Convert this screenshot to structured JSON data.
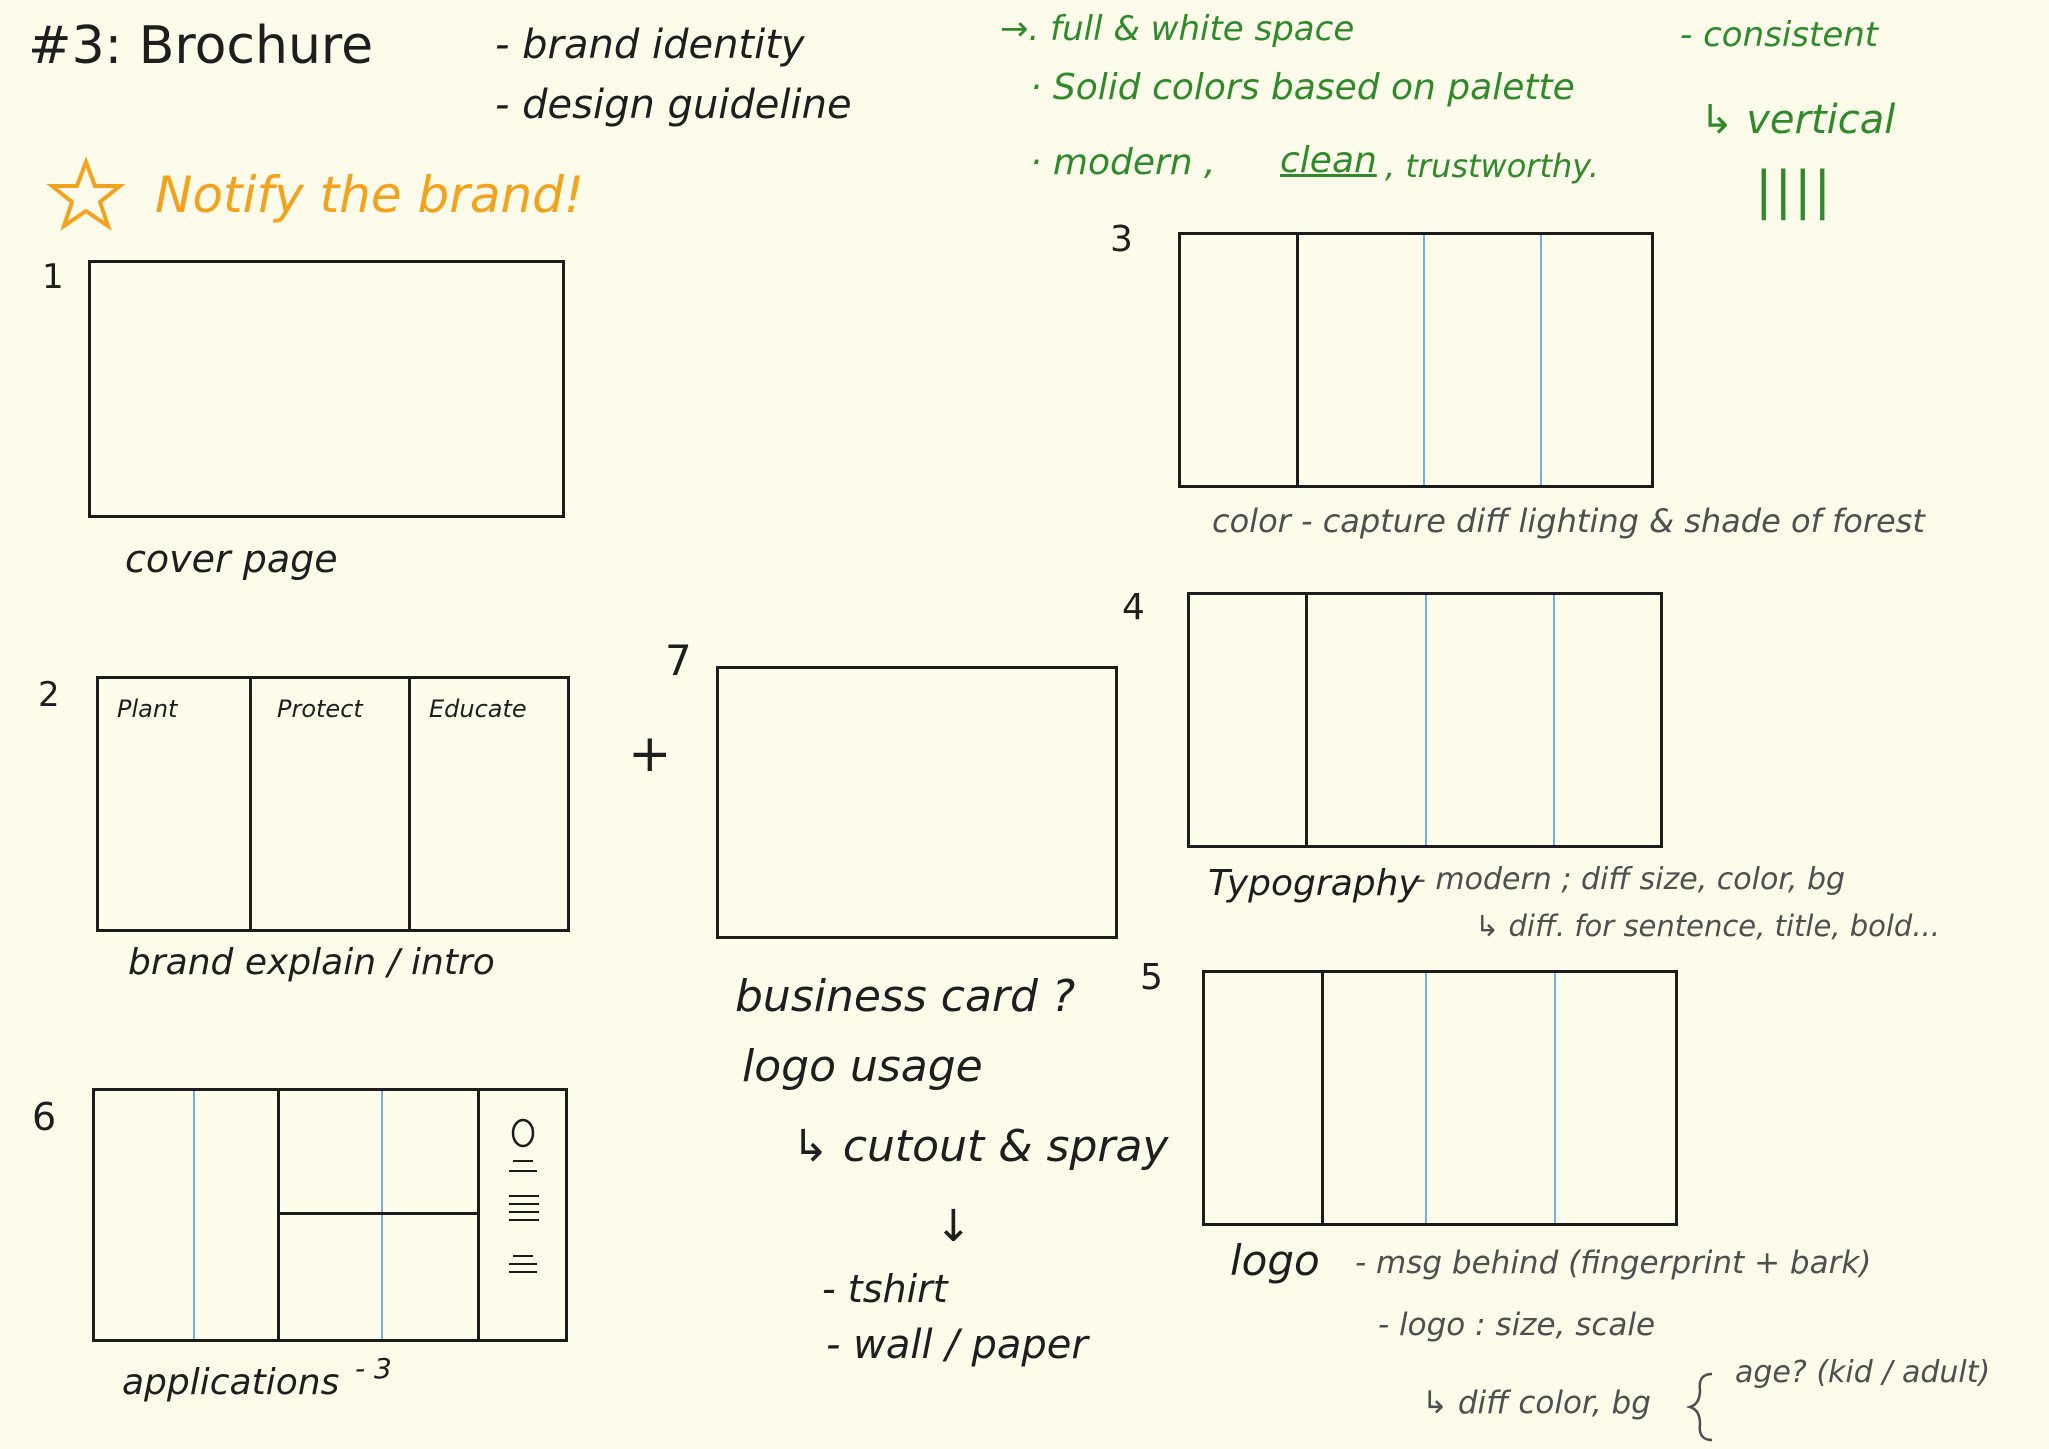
{
  "title": "#3: Brochure",
  "goals": [
    "- brand identity",
    "-  design   guideline"
  ],
  "notify": "Notify  the  brand!",
  "green_notes": {
    "line1": "→. full & white space",
    "line2": "· Solid   colors  based  on  palette",
    "line3_a": "· modern ,",
    "line3_clean": "clean",
    "line3_b": ", trustworthy.",
    "right1": "- consistent",
    "right2": "↳ vertical",
    "right3": "||||"
  },
  "numbers": {
    "n1": "1",
    "n2": "2",
    "n3": "3",
    "n4": "4",
    "n5": "5",
    "n6": "6",
    "n7": "7"
  },
  "captions": {
    "cover": "cover  page",
    "brand": "brand  explain / intro",
    "applications": "applications",
    "applications_note": "- 3",
    "color": "color  -  capture  diff  lighting  & shade  of  forest",
    "typography": "Typography",
    "typography_note": "- modern  ; diff  size, color, bg",
    "typography_sub": "↳ diff.  for  sentence,  title,  bold...",
    "logo": "logo",
    "logo_note1": "-   msg   behind  (fingerprint + bark)",
    "logo_note2": "-   logo  : size, scale",
    "logo_note3": "↳ diff  color, bg",
    "logo_note4": "age? (kid / adult)",
    "business": "business   card ?",
    "logo_usage": "logo  usage",
    "cutout": "↳ cutout & spray",
    "arrow_down": "↓",
    "tshirt": "- tshirt",
    "wall": "- wall / paper",
    "plus": "+"
  },
  "box2_labels": [
    "Plant",
    "Protect",
    "Educate"
  ],
  "colors": {
    "ink": "#1c1c1c",
    "green": "#2f8a2b",
    "orange": "#f2a21c",
    "blue_line": "#6fb0e6",
    "paper": "#fdfbea"
  },
  "icons": [
    "star-icon"
  ]
}
